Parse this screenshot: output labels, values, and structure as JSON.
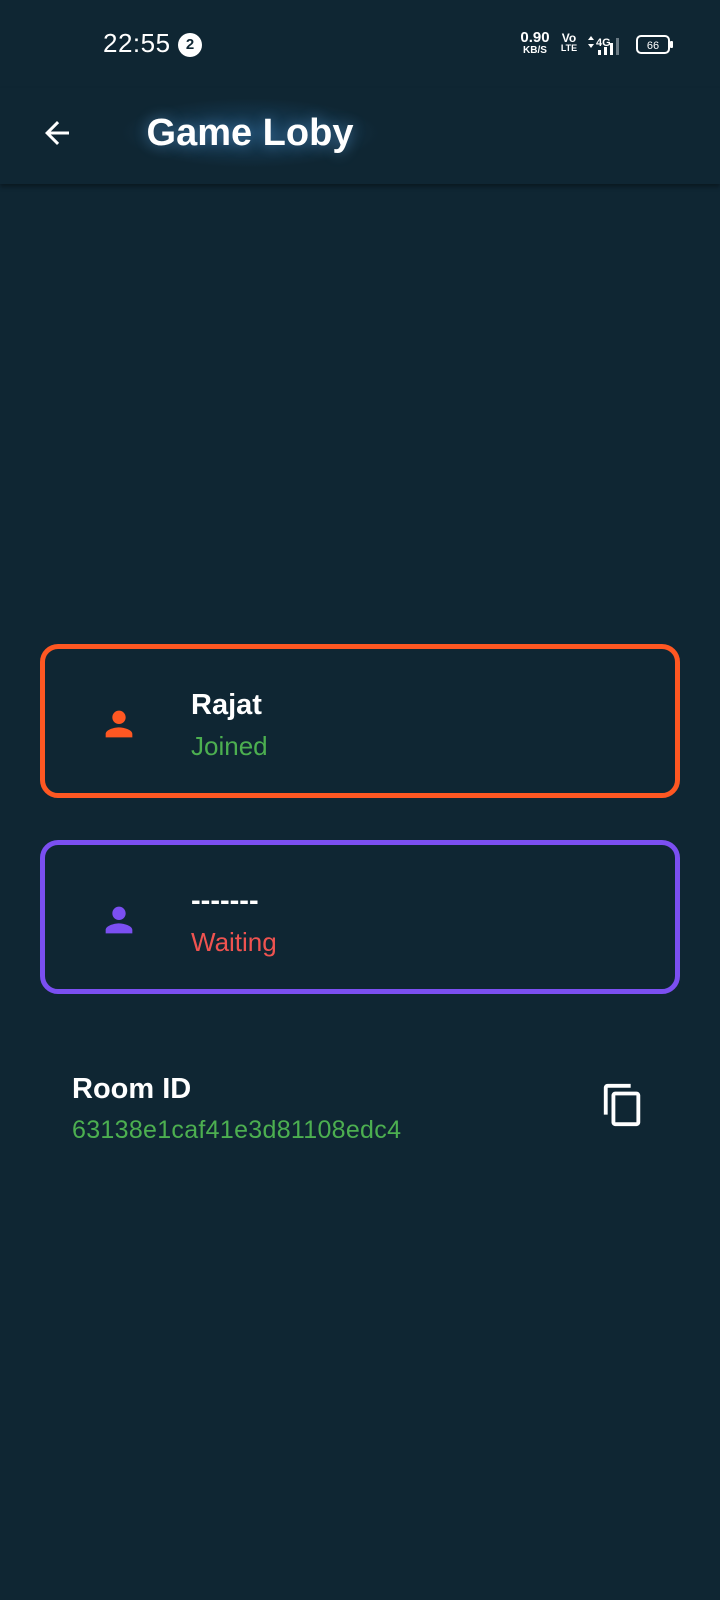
{
  "status_bar": {
    "time": "22:55",
    "notification_count": "2",
    "net_speed_value": "0.90",
    "net_speed_unit": "KB/S",
    "volte_top": "Vo",
    "volte_bottom": "LTE",
    "network_type": "4G",
    "battery_level": "66"
  },
  "app_bar": {
    "back_icon": "arrow-left-icon",
    "title": "Game Loby"
  },
  "players": [
    {
      "name": "Rajat",
      "status": "Joined",
      "icon": "person-icon",
      "accent_color": "#fe5722",
      "status_color": "#4caf50"
    },
    {
      "name": "-------",
      "status": "Waiting",
      "icon": "person-icon",
      "accent_color": "#7b4ff1",
      "status_color": "#ef5350"
    }
  ],
  "room": {
    "label": "Room ID",
    "id": "63138e1caf41e3d81108edc4",
    "copy_icon": "copy-icon"
  },
  "colors": {
    "background": "#0f2633",
    "text": "#ffffff"
  }
}
